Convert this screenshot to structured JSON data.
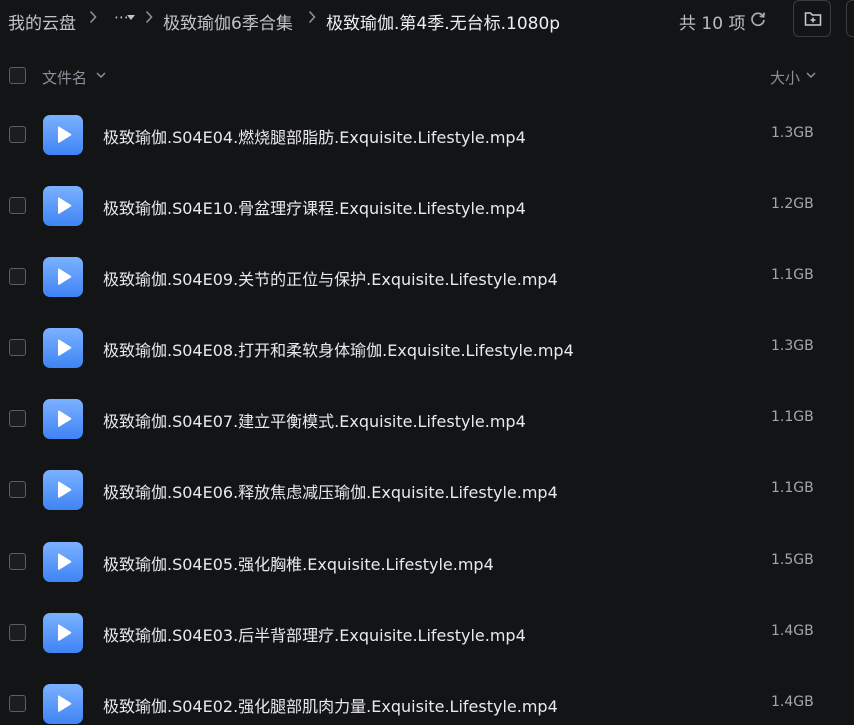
{
  "breadcrumb": {
    "root": "我的云盘",
    "more": "⋯",
    "parent": "极致瑜伽6季合集",
    "current": "极致瑜伽.第4季.无台标.1080p"
  },
  "toolbar": {
    "item_count": "共 10 项",
    "refresh_icon": "refresh-icon",
    "new_folder_icon": "new-folder-icon"
  },
  "table": {
    "columns": {
      "name": "文件名",
      "size": "大小"
    },
    "rows": [
      {
        "name": "极致瑜伽.S04E04.燃烧腿部脂肪.Exquisite.Lifestyle.mp4",
        "size": "1.3GB"
      },
      {
        "name": "极致瑜伽.S04E10.骨盆理疗课程.Exquisite.Lifestyle.mp4",
        "size": "1.2GB"
      },
      {
        "name": "极致瑜伽.S04E09.关节的正位与保护.Exquisite.Lifestyle.mp4",
        "size": "1.1GB"
      },
      {
        "name": "极致瑜伽.S04E08.打开和柔软身体瑜伽.Exquisite.Lifestyle.mp4",
        "size": "1.3GB"
      },
      {
        "name": "极致瑜伽.S04E07.建立平衡模式.Exquisite.Lifestyle.mp4",
        "size": "1.1GB"
      },
      {
        "name": "极致瑜伽.S04E06.释放焦虑减压瑜伽.Exquisite.Lifestyle.mp4",
        "size": "1.1GB"
      },
      {
        "name": "极致瑜伽.S04E05.强化胸椎.Exquisite.Lifestyle.mp4",
        "size": "1.5GB"
      },
      {
        "name": "极致瑜伽.S04E03.后半背部理疗.Exquisite.Lifestyle.mp4",
        "size": "1.4GB"
      },
      {
        "name": "极致瑜伽.S04E02.强化腿部肌肉力量.Exquisite.Lifestyle.mp4",
        "size": "1.4GB"
      }
    ]
  },
  "colors": {
    "background": "#131416",
    "video_icon_top": "#7bb1ff",
    "video_icon_bottom": "#3f84f5"
  }
}
